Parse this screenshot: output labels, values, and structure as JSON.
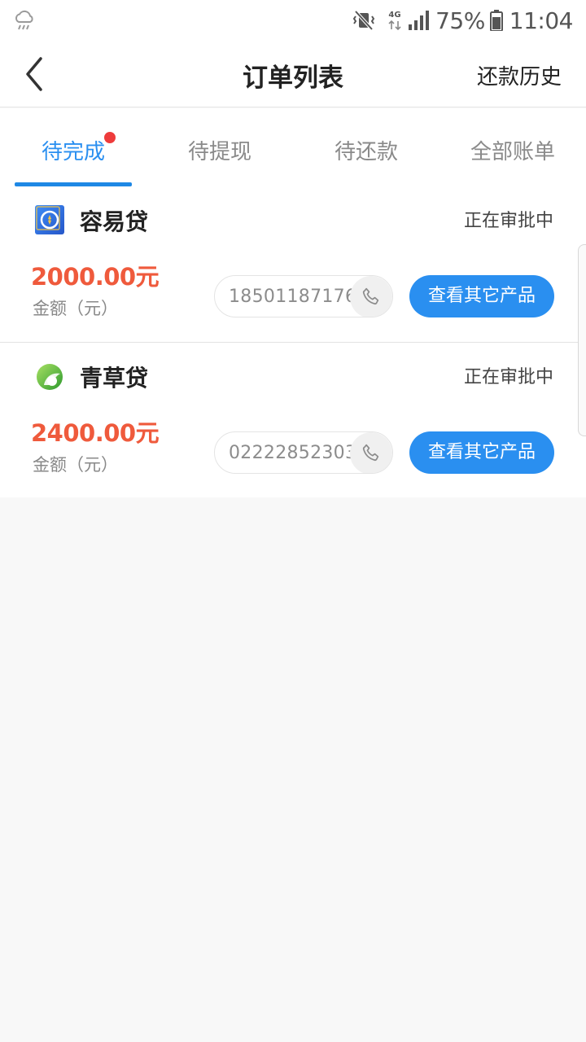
{
  "status_bar": {
    "weather_icon": "cloud-rain-icon",
    "mute_icon": "vibrate-mute-icon",
    "network": "4G",
    "signal_icon": "signal-icon",
    "battery_percent": "75%",
    "battery_icon": "battery-icon",
    "time": "11:04"
  },
  "header": {
    "back_icon": "chevron-left-icon",
    "title": "订单列表",
    "history_label": "还款历史"
  },
  "tabs": [
    {
      "label": "待完成",
      "active": true,
      "badge": true
    },
    {
      "label": "待提现",
      "active": false
    },
    {
      "label": "待还款",
      "active": false
    },
    {
      "label": "全部账单",
      "active": false
    }
  ],
  "orders": [
    {
      "product_name": "容易贷",
      "logo_icon": "rongyidai-logo",
      "status": "正在审批中",
      "amount": "2000.00元",
      "amount_label": "金额（元）",
      "phone": "18501187176",
      "phone_icon": "phone-icon",
      "action_label": "查看其它产品"
    },
    {
      "product_name": "青草贷",
      "logo_icon": "qingcaodai-logo",
      "status": "正在审批中",
      "amount": "2400.00元",
      "amount_label": "金额（元）",
      "phone": "02222852303",
      "phone_icon": "phone-icon",
      "action_label": "查看其它产品"
    }
  ],
  "colors": {
    "accent": "#2a8ff0",
    "amount": "#ef5a3c",
    "badge": "#ee3b3b"
  }
}
